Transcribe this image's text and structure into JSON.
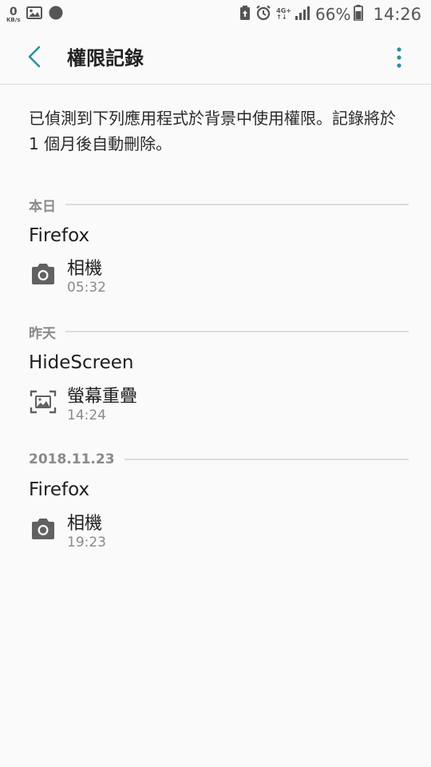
{
  "status_bar": {
    "net_speed": "0",
    "net_unit": "KB/s",
    "network_type": "4G+",
    "battery_percent": "66%",
    "time": "14:26"
  },
  "app_bar": {
    "title": "權限記錄"
  },
  "description": "已偵測到下列應用程式於背景中使用權限。記錄將於 1 個月後自動刪除。",
  "sections": [
    {
      "header": "本日",
      "app": "Firefox",
      "permission": "相機",
      "time": "05:32",
      "icon": "camera-icon"
    },
    {
      "header": "昨天",
      "app": "HideScreen",
      "permission": "螢幕重疊",
      "time": "14:24",
      "icon": "screen-overlay-icon"
    },
    {
      "header": "2018.11.23",
      "app": "Firefox",
      "permission": "相機",
      "time": "19:23",
      "icon": "camera-icon"
    }
  ],
  "colors": {
    "accent": "#2e8fa3",
    "background": "#fafafa",
    "secondary_text": "#8a8a8a",
    "divider": "#dcdcdc"
  }
}
